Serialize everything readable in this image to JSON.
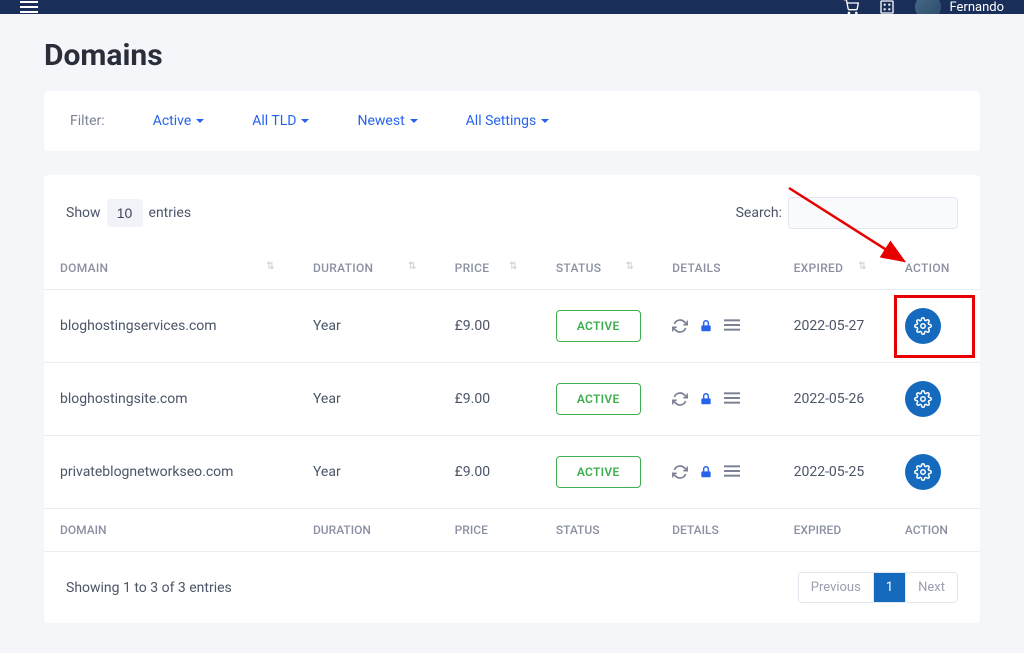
{
  "header": {
    "user_name": "Fernando"
  },
  "page": {
    "title": "Domains"
  },
  "filter": {
    "label": "Filter:",
    "items": [
      "Active",
      "All TLD",
      "Newest",
      "All Settings"
    ]
  },
  "table": {
    "show_prefix": "Show",
    "show_value": "10",
    "show_suffix": "entries",
    "search_label": "Search:",
    "columns": {
      "domain": "DOMAIN",
      "duration": "DURATION",
      "price": "PRICE",
      "status": "STATUS",
      "details": "DETAILS",
      "expired": "EXPIRED",
      "action": "ACTION"
    },
    "rows": [
      {
        "domain": "bloghostingservices.com",
        "duration": "Year",
        "price": "£9.00",
        "status": "ACTIVE",
        "expired": "2022-05-27"
      },
      {
        "domain": "bloghostingsite.com",
        "duration": "Year",
        "price": "£9.00",
        "status": "ACTIVE",
        "expired": "2022-05-26"
      },
      {
        "domain": "privateblognetworkseo.com",
        "duration": "Year",
        "price": "£9.00",
        "status": "ACTIVE",
        "expired": "2022-05-25"
      }
    ],
    "info": "Showing 1 to 3 of 3 entries",
    "pagination": {
      "prev": "Previous",
      "current": "1",
      "next": "Next"
    }
  }
}
